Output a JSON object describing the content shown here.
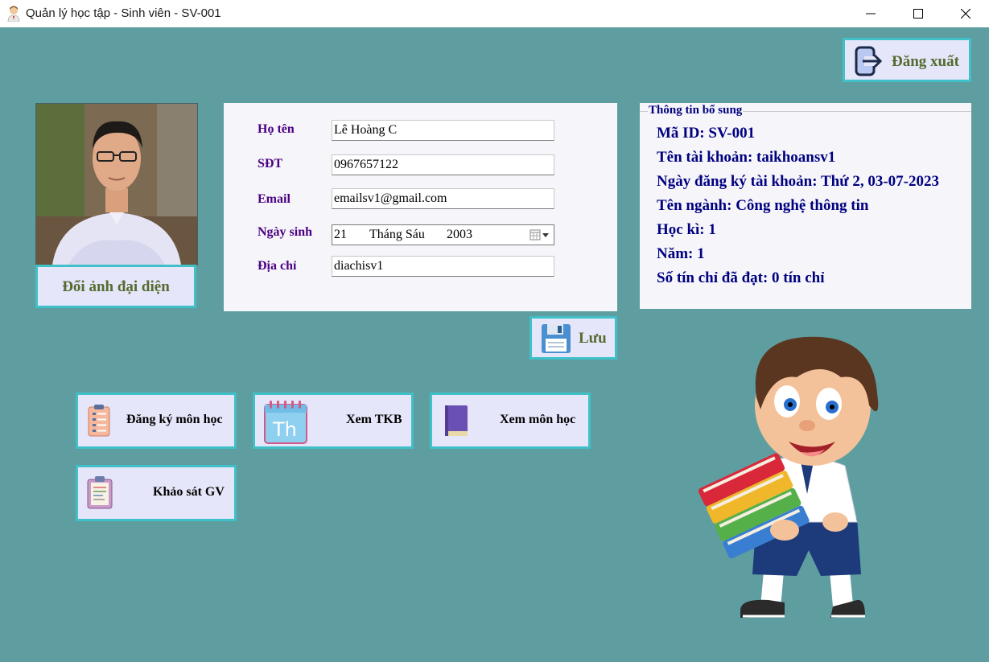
{
  "window": {
    "title": "Quản lý học tập - Sinh viên - SV-001",
    "minimize_icon": "minimize-icon",
    "maximize_icon": "maximize-icon",
    "close_icon": "close-icon"
  },
  "header": {
    "logout_label": "Đăng xuất",
    "logout_icon": "logout-icon"
  },
  "profile": {
    "avatar": "student-photo",
    "change_avatar_label": "Đổi ảnh đại diện"
  },
  "form": {
    "fields": [
      {
        "label": "Họ tên",
        "value": "Lê Hoàng C"
      },
      {
        "label": "SĐT",
        "value": "0967657122"
      },
      {
        "label": "Email",
        "value": "emailsv1@gmail.com"
      },
      {
        "label": "Ngày sinh",
        "day": "21",
        "month": "Tháng Sáu",
        "year": "2003"
      },
      {
        "label": "Địa chỉ",
        "value": "diachisv1"
      }
    ],
    "save_label": "Lưu",
    "save_icon": "floppy-disk-icon"
  },
  "info": {
    "legend": "Thông tin bổ sung",
    "items": [
      "Mã ID: SV-001",
      "Tên tài khoản: taikhoansv1",
      "Ngày đăng ký tài khoản: Thứ 2, 03-07-2023",
      "Tên ngành: Công nghệ thông tin",
      "Học kì: 1",
      "Năm: 1",
      "Số tín chỉ đã đạt: 0 tín chỉ"
    ]
  },
  "actions": [
    {
      "label": "Đăng ký môn học",
      "icon": "clipboard-list-icon"
    },
    {
      "label": "Xem TKB",
      "icon": "calendar-icon"
    },
    {
      "label": "Xem môn học",
      "icon": "book-icon"
    },
    {
      "label": "Khảo sát GV",
      "icon": "survey-clipboard-icon"
    }
  ],
  "colors": {
    "background": "#5f9ea0",
    "button_bg": "#e6e6fa",
    "button_border": "#40c0c8",
    "label_purple": "#4b0082",
    "info_navy": "#000080",
    "button_text_olive": "#556b2f"
  }
}
